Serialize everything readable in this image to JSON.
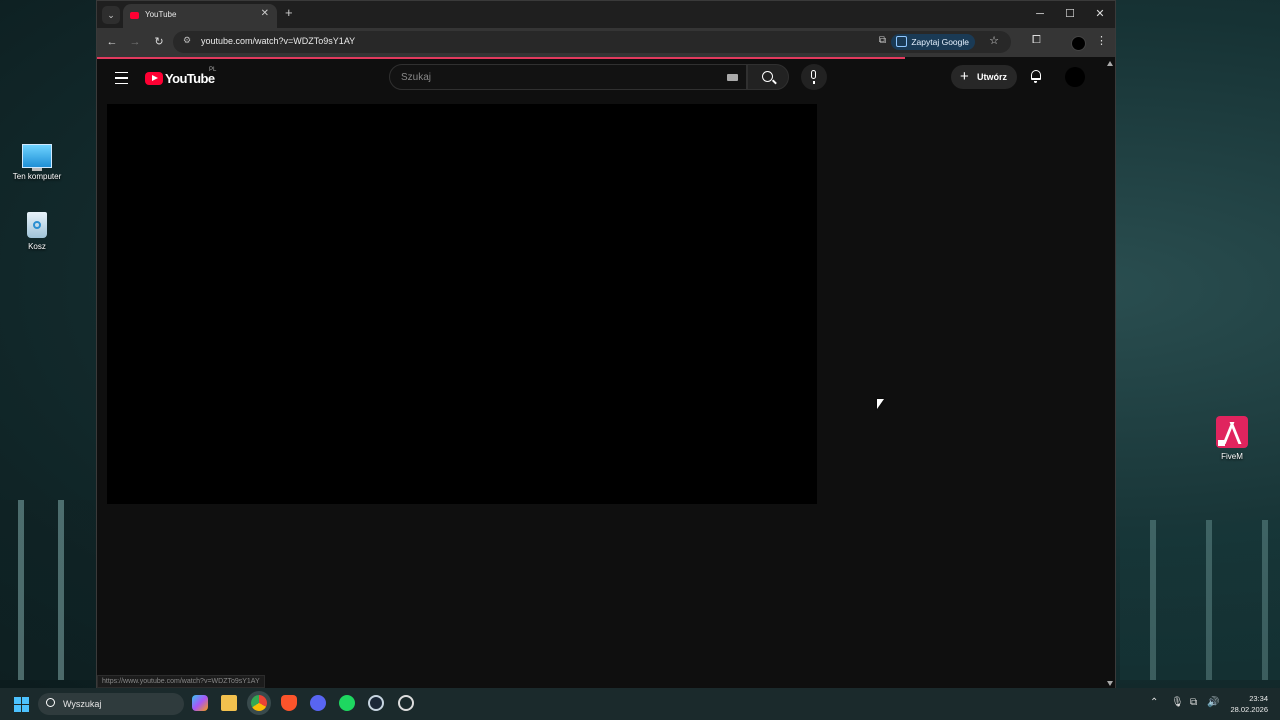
{
  "desktop": {
    "icons": [
      {
        "label": "Ten komputer",
        "icon": "monitor-icon"
      },
      {
        "label": "Kosz",
        "icon": "recycle-bin-icon"
      },
      {
        "label": "FiveM",
        "icon": "fivem-icon"
      }
    ]
  },
  "browser": {
    "tab": {
      "title": "YouTube",
      "favicon": "youtube-favicon-icon"
    },
    "new_tab_glyph": "+",
    "window_controls": {
      "minimize": "─",
      "maximize": "☐",
      "close": "✕"
    },
    "address": {
      "url": "youtube.com/watch?v=WDZTo9sY1AY"
    },
    "ask_google_label": "Zapytaj Google",
    "status_url": "https://www.youtube.com/watch?v=WDZTo9sY1AY"
  },
  "youtube": {
    "logo_text": "YouTube",
    "country_code": "PL",
    "search": {
      "placeholder": "Szukaj"
    },
    "create_label": "Utwórz",
    "create_glyph": "+"
  },
  "taskbar": {
    "search_label": "Wyszukaj",
    "apps": [
      "copilot-icon",
      "file-explorer-icon",
      "chrome-icon",
      "brave-icon",
      "discord-icon",
      "spotify-icon",
      "steam-icon",
      "app-icon"
    ],
    "clock": {
      "time": "23:34",
      "date": "28.02.2026"
    }
  },
  "colors": {
    "youtube_red": "#ff0033",
    "page_bg": "#0f0f0f",
    "load_bar": "#e23a5e",
    "ask_google_bg": "#1a3a55"
  }
}
